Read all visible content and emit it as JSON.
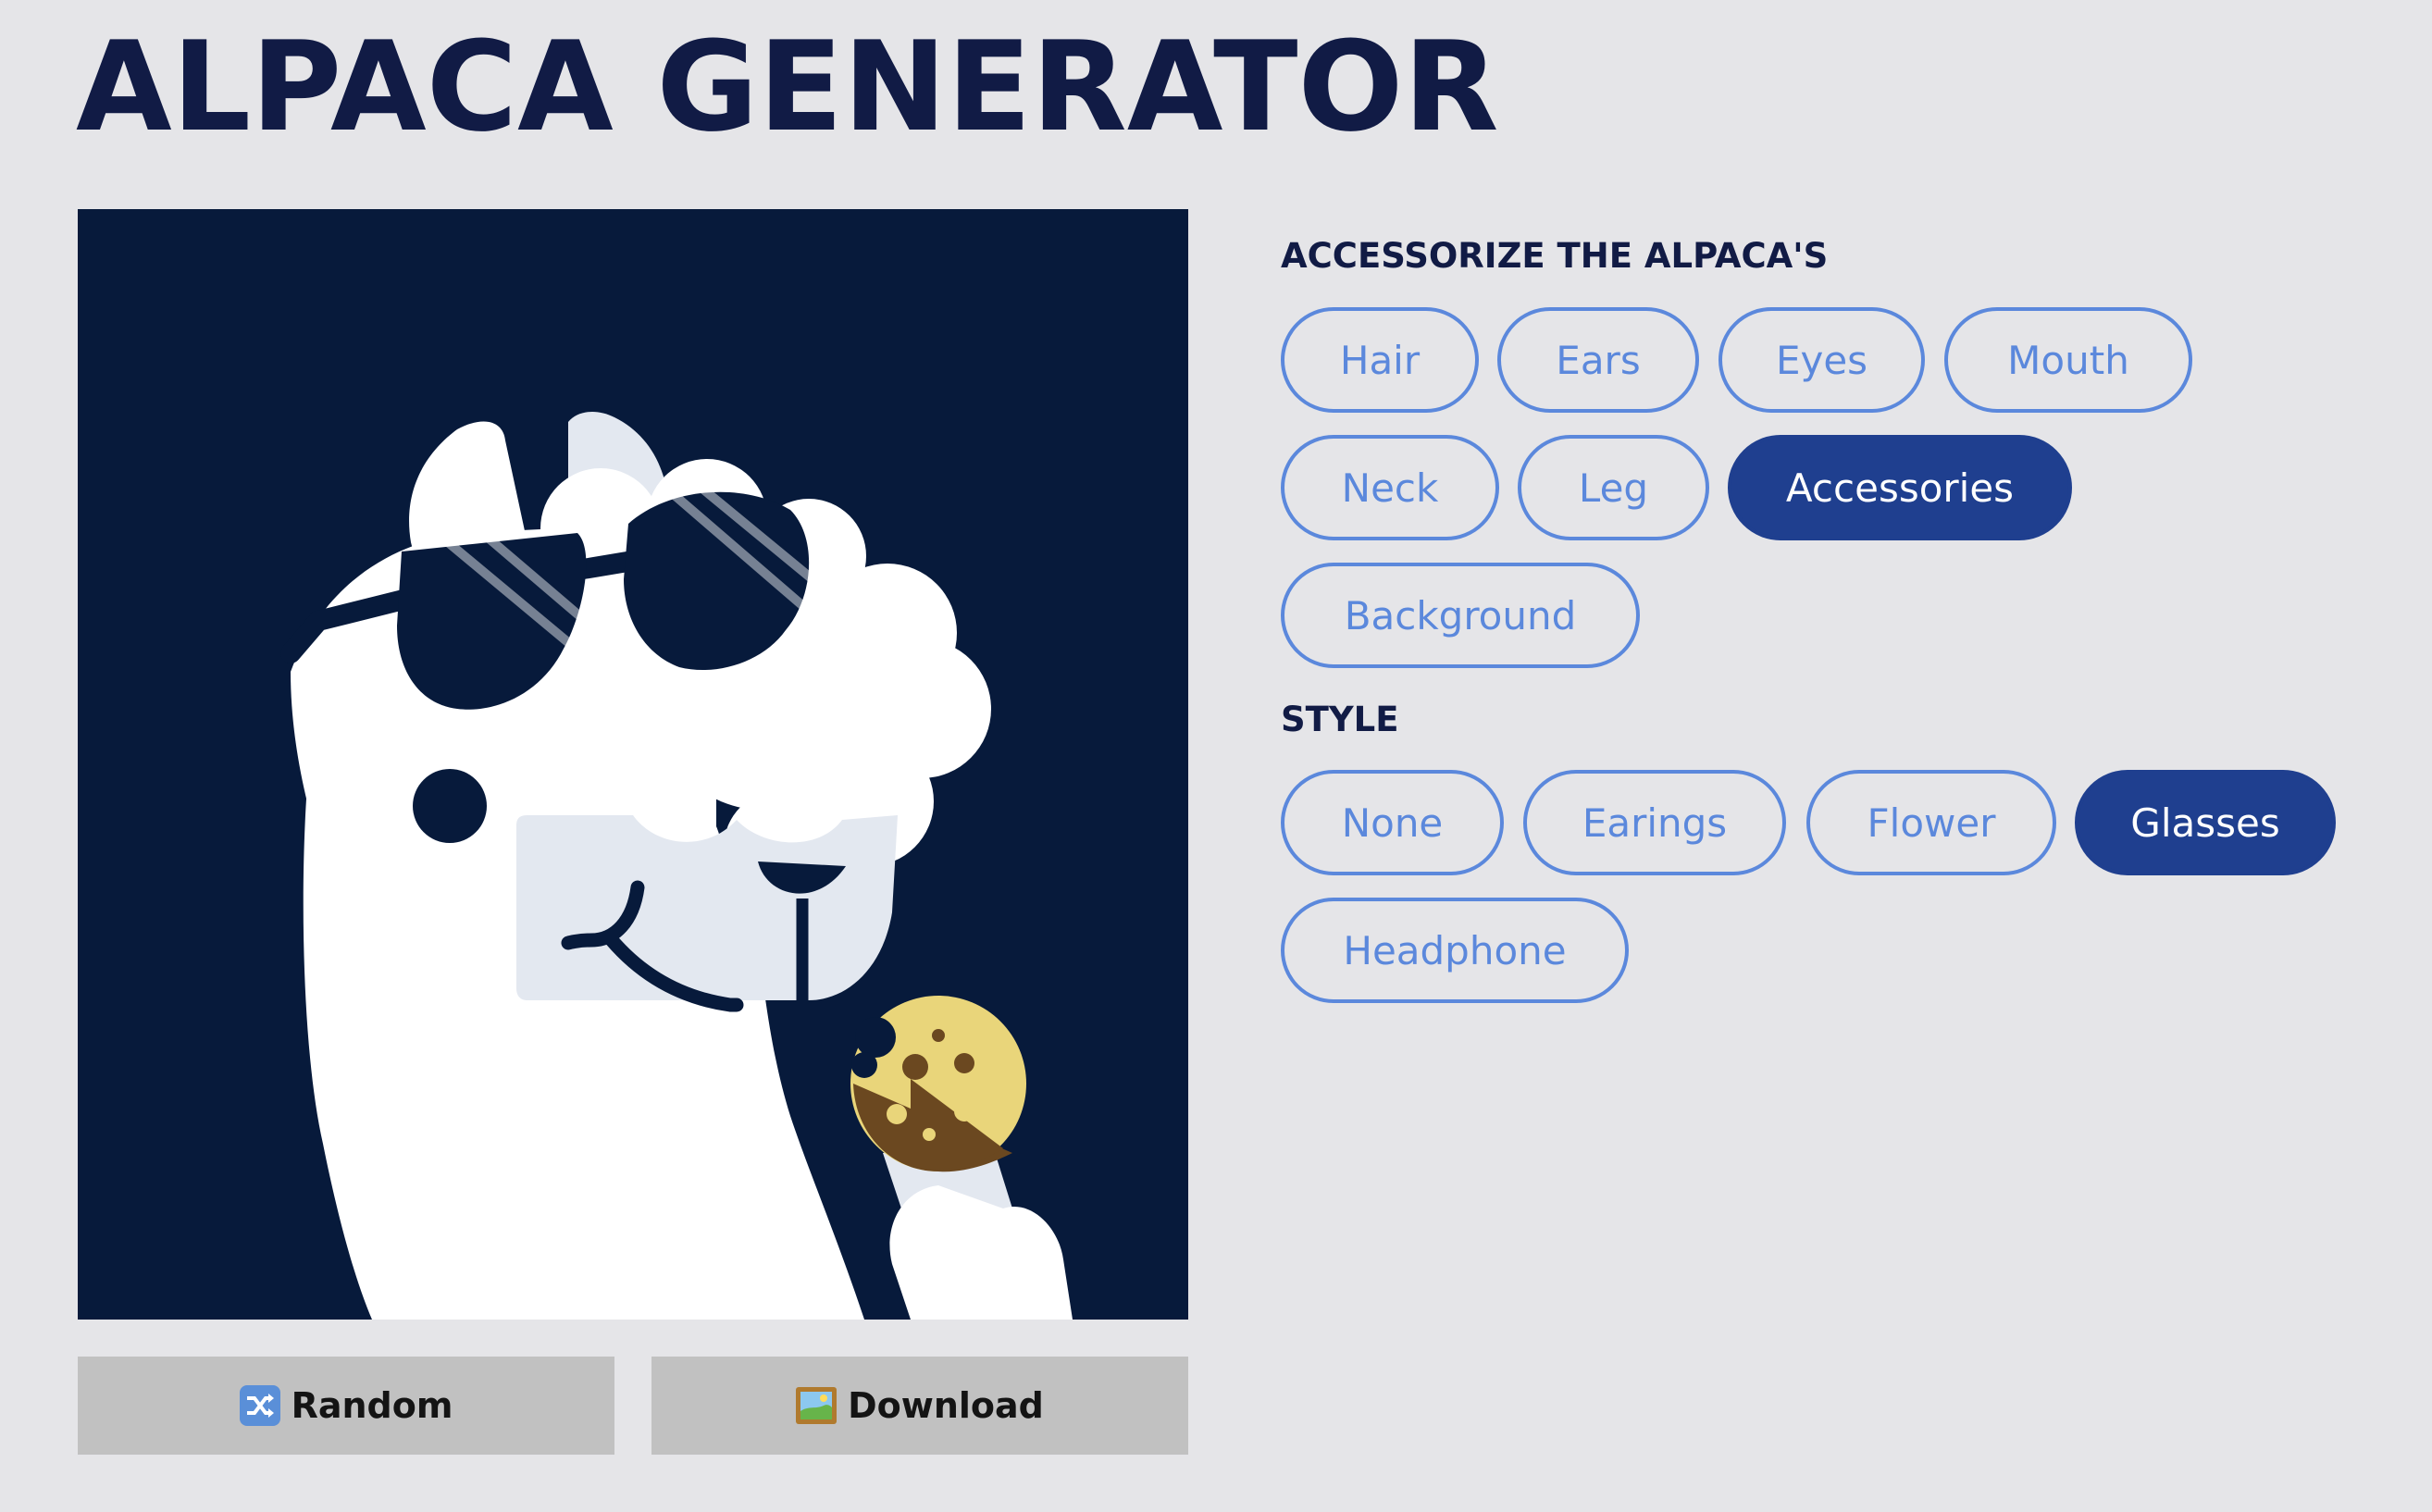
{
  "title": "ALPACA GENERATOR",
  "colors": {
    "background": "#e5e5e8",
    "title": "#111b45",
    "pill_border": "#5b88dc",
    "pill_text": "#5b88dc",
    "pill_active_bg": "#1f3f8f",
    "pill_active_text": "#ffffff",
    "button_bg": "#c1c1c1",
    "alpaca_background": "#071a3b"
  },
  "actions": {
    "random_label": "Random",
    "random_icon": "shuffle-icon",
    "download_label": "Download",
    "download_icon": "framed-picture-icon"
  },
  "accessorize": {
    "heading": "ACCESSORIZE THE ALPACA'S",
    "options": [
      {
        "label": "Hair",
        "active": false
      },
      {
        "label": "Ears",
        "active": false
      },
      {
        "label": "Eyes",
        "active": false
      },
      {
        "label": "Mouth",
        "active": false
      },
      {
        "label": "Neck",
        "active": false
      },
      {
        "label": "Leg",
        "active": false
      },
      {
        "label": "Accessories",
        "active": true
      },
      {
        "label": "Background",
        "active": false
      }
    ]
  },
  "style": {
    "heading": "STYLE",
    "options": [
      {
        "label": "None",
        "active": false
      },
      {
        "label": "Earings",
        "active": false
      },
      {
        "label": "Flower",
        "active": false
      },
      {
        "label": "Glasses",
        "active": true
      },
      {
        "label": "Headphone",
        "active": false
      }
    ]
  }
}
